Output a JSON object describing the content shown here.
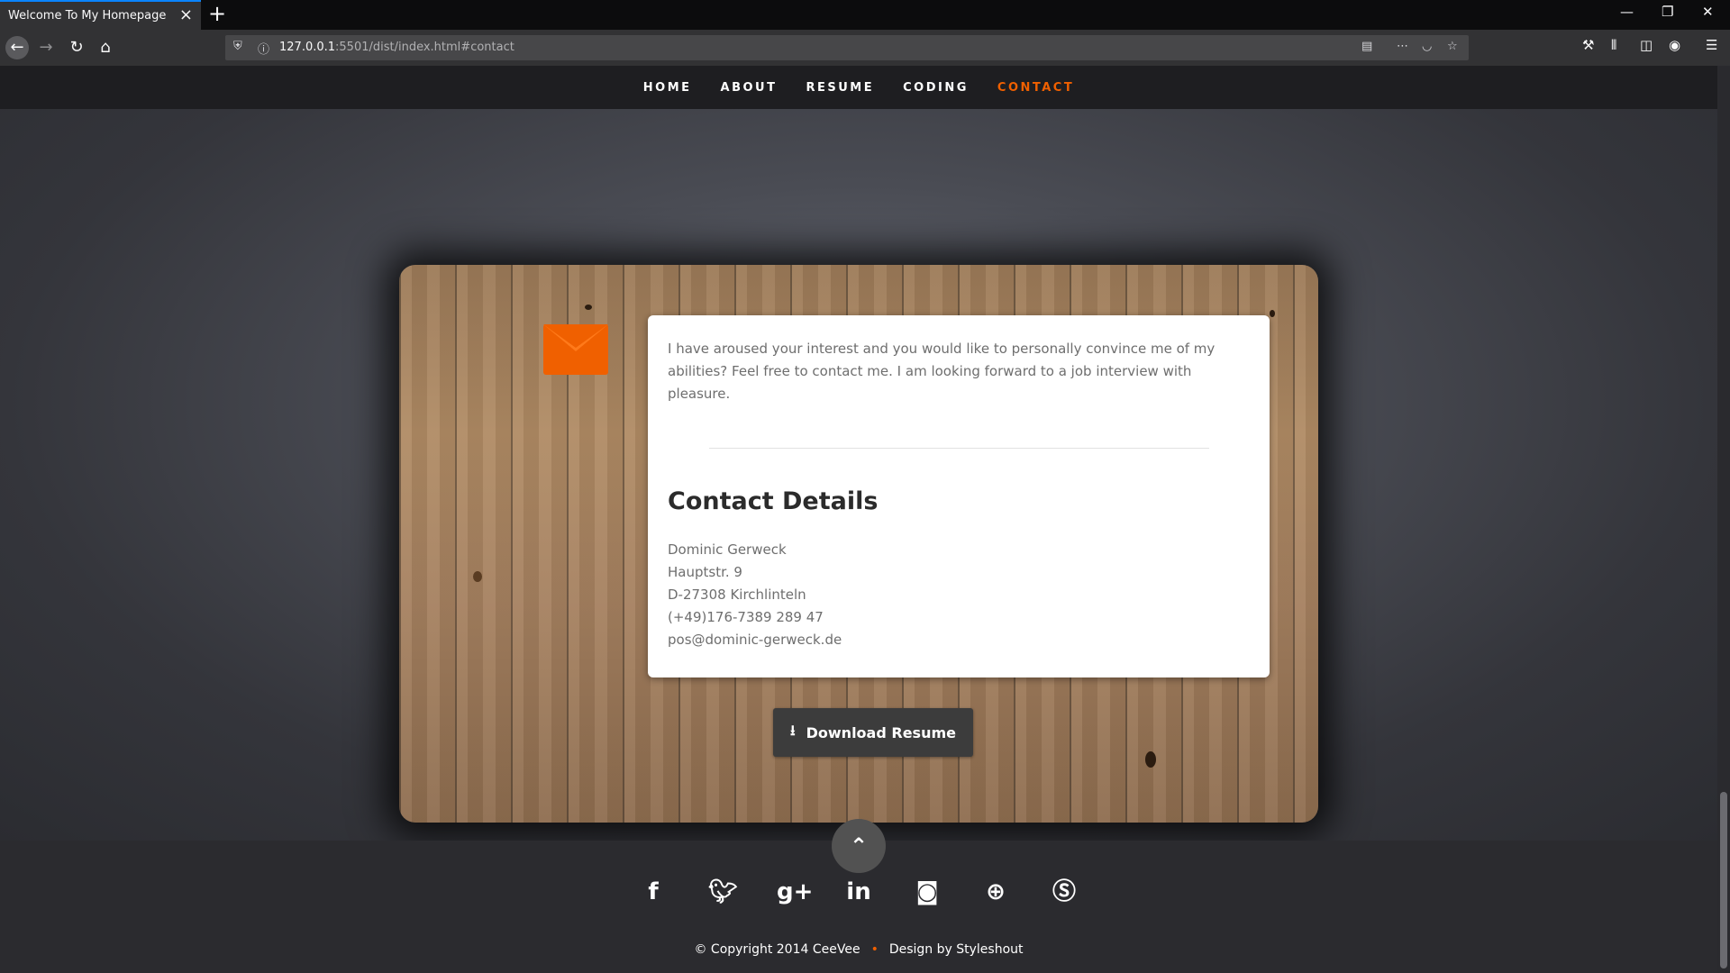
{
  "browser": {
    "tab_title": "Welcome To My Homepage",
    "url_host": "127.0.0.1",
    "url_path": ":5501/dist/index.html#contact"
  },
  "nav": {
    "items": [
      "HOME",
      "ABOUT",
      "RESUME",
      "CODING",
      "CONTACT"
    ],
    "active": "CONTACT",
    "active_color": "#f06000"
  },
  "contact": {
    "intro": "I have aroused your interest and you would like to personally convince me of my abilities? Feel free to contact me. I am looking forward to a job interview with pleasure.",
    "heading": "Contact Details",
    "name": "Dominic Gerweck",
    "street": "Hauptstr. 9",
    "city": "D-27308 Kirchlinteln",
    "phone": "(+49)176-7389 289 47",
    "email": "pos@dominic-gerweck.de",
    "download_label": "Download Resume"
  },
  "footer": {
    "socials": [
      "facebook-icon",
      "twitter-icon",
      "google-plus-icon",
      "linkedin-icon",
      "instagram-icon",
      "dribbble-icon",
      "skype-icon"
    ],
    "copyright": "© Copyright 2014 CeeVee",
    "design": "Design by Styleshout"
  }
}
